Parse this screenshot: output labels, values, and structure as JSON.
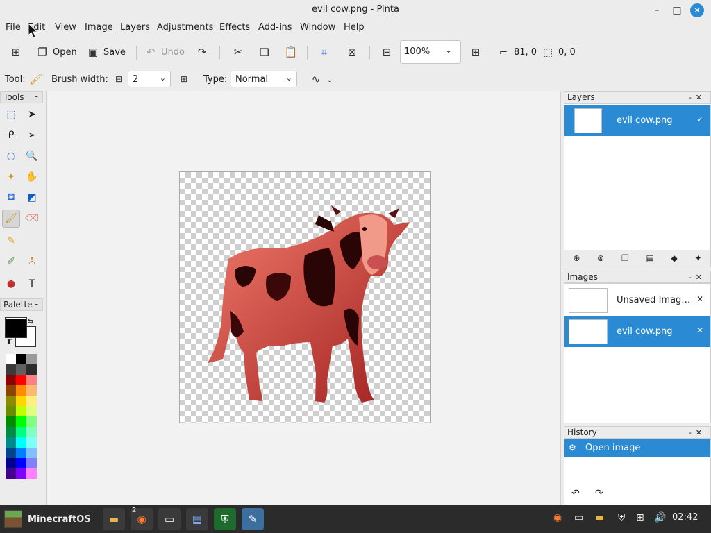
{
  "window": {
    "title": "evil cow.png - Pinta"
  },
  "menu": [
    "File",
    "Edit",
    "View",
    "Image",
    "Layers",
    "Adjustments",
    "Effects",
    "Add-ins",
    "Window",
    "Help"
  ],
  "toolbar": {
    "open_label": "Open",
    "save_label": "Save",
    "undo_label": "Undo",
    "zoom_value": "100%",
    "cursor_pos": "81, 0",
    "selection_size": "0, 0"
  },
  "tool_options": {
    "tool_label": "Tool:",
    "brush_width_label": "Brush width:",
    "brush_width_value": "2",
    "type_label": "Type:",
    "type_value": "Normal"
  },
  "panels": {
    "tools_title": "Tools",
    "palette_title": "Palette",
    "layers_title": "Layers",
    "images_title": "Images",
    "history_title": "History"
  },
  "layers": [
    {
      "name": "evil cow.png"
    }
  ],
  "images": [
    {
      "name": "Unsaved Imag…"
    },
    {
      "name": "evil cow.png"
    }
  ],
  "history": [
    {
      "label": "Open image"
    }
  ],
  "taskbar": {
    "start_label": "MinecraftOS",
    "badge_count": "2",
    "clock": "02:42"
  },
  "colors": {
    "accent": "#2a8ad4",
    "primary": "#000000",
    "secondary": "#ffffff"
  },
  "palette_swatches": [
    "#ffffff",
    "#000000",
    "#9a9a9a",
    "#3a3a3a",
    "#606060",
    "#2c2c2c",
    "#8b0000",
    "#ff0000",
    "#ff8080",
    "#8b4500",
    "#ff8c00",
    "#ffb870",
    "#8b8b00",
    "#ffd700",
    "#fff080",
    "#6b8b00",
    "#c0ff00",
    "#e0ff80",
    "#008b00",
    "#00ff00",
    "#80ff80",
    "#008b45",
    "#00ff80",
    "#80ffc0",
    "#008b8b",
    "#00ffff",
    "#80ffff",
    "#00458b",
    "#0080ff",
    "#80c0ff",
    "#00008b",
    "#0000ff",
    "#8080ff",
    "#45008b",
    "#8000ff",
    "#ff80ff"
  ]
}
